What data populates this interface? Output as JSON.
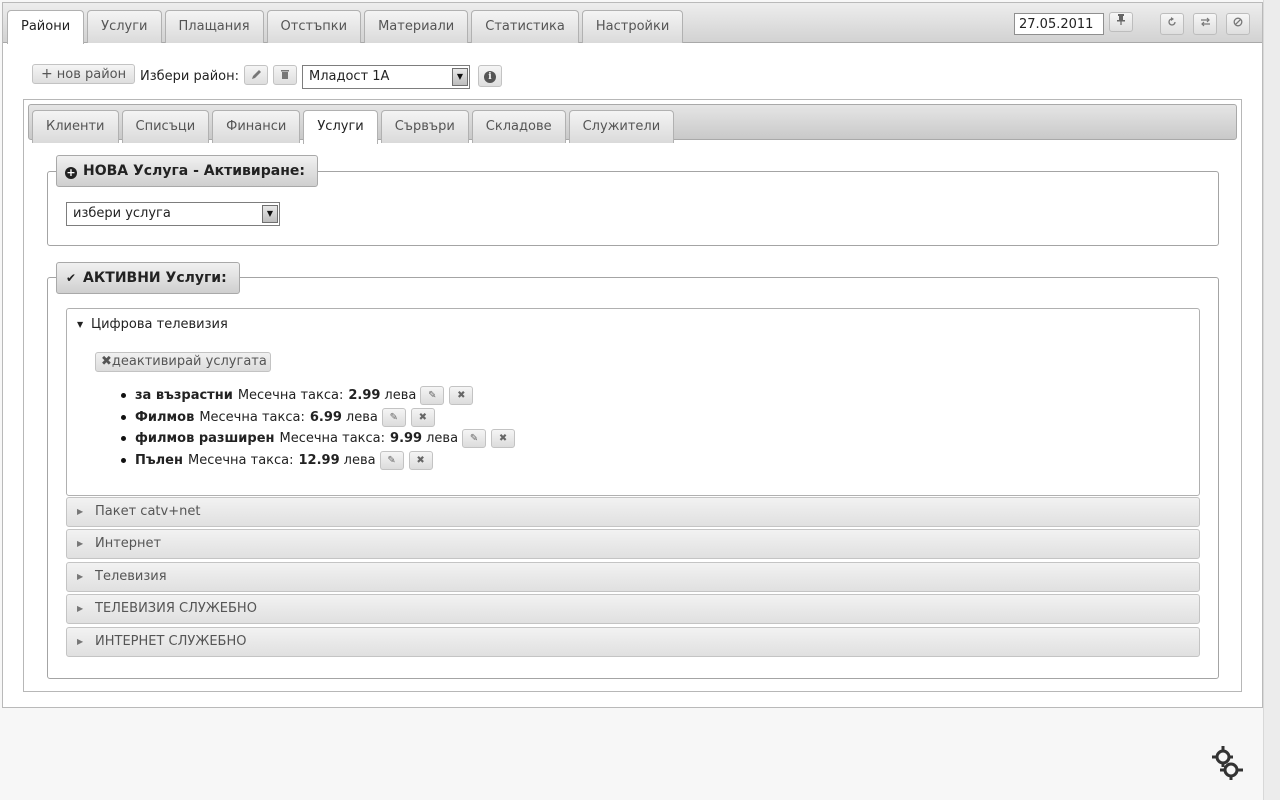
{
  "top_nav": {
    "tabs": [
      {
        "label": "Райони",
        "active": true
      },
      {
        "label": "Услуги"
      },
      {
        "label": "Плащания"
      },
      {
        "label": "Отстъпки"
      },
      {
        "label": "Материали"
      },
      {
        "label": "Статистика"
      },
      {
        "label": "Настройки"
      }
    ],
    "date": "27.05.2011",
    "icons": [
      "pin-icon",
      "refresh-icon",
      "swap-icon",
      "block-icon"
    ]
  },
  "toolbar": {
    "new_district_label": "нов район",
    "choose_district_label": "Избери район:",
    "selected_district": "Младост 1А"
  },
  "sub_nav": {
    "tabs": [
      {
        "label": "Клиенти"
      },
      {
        "label": "Списъци"
      },
      {
        "label": "Финанси"
      },
      {
        "label": "Услуги",
        "active": true
      },
      {
        "label": "Сървъри"
      },
      {
        "label": "Складове"
      },
      {
        "label": "Служители"
      }
    ]
  },
  "new_service": {
    "legend": "НОВА Услуга - Активиране:",
    "select_value": "избери услуга"
  },
  "active_services": {
    "legend": "АКТИВНИ Услуги:",
    "open_group": {
      "title": "Цифрова телевизия",
      "deactivate_label": "деактивирай услугата",
      "items": [
        {
          "name": "за възрастни",
          "fee_label": "Месечна такса:",
          "price": "2.99",
          "currency": "лева"
        },
        {
          "name": "Филмов",
          "fee_label": "Месечна такса:",
          "price": "6.99",
          "currency": "лева"
        },
        {
          "name": "филмов разширен",
          "fee_label": "Месечна такса:",
          "price": "9.99",
          "currency": "лева"
        },
        {
          "name": "Пълен",
          "fee_label": "Месечна такса:",
          "price": "12.99",
          "currency": "лева"
        }
      ]
    },
    "closed_groups": [
      {
        "title": "Пакет catv+net"
      },
      {
        "title": "Интернет"
      },
      {
        "title": "Телевизия"
      },
      {
        "title": "ТЕЛЕВИЗИЯ СЛУЖЕБНО"
      },
      {
        "title": "ИНТЕРНЕТ СЛУЖЕБНО"
      }
    ]
  }
}
